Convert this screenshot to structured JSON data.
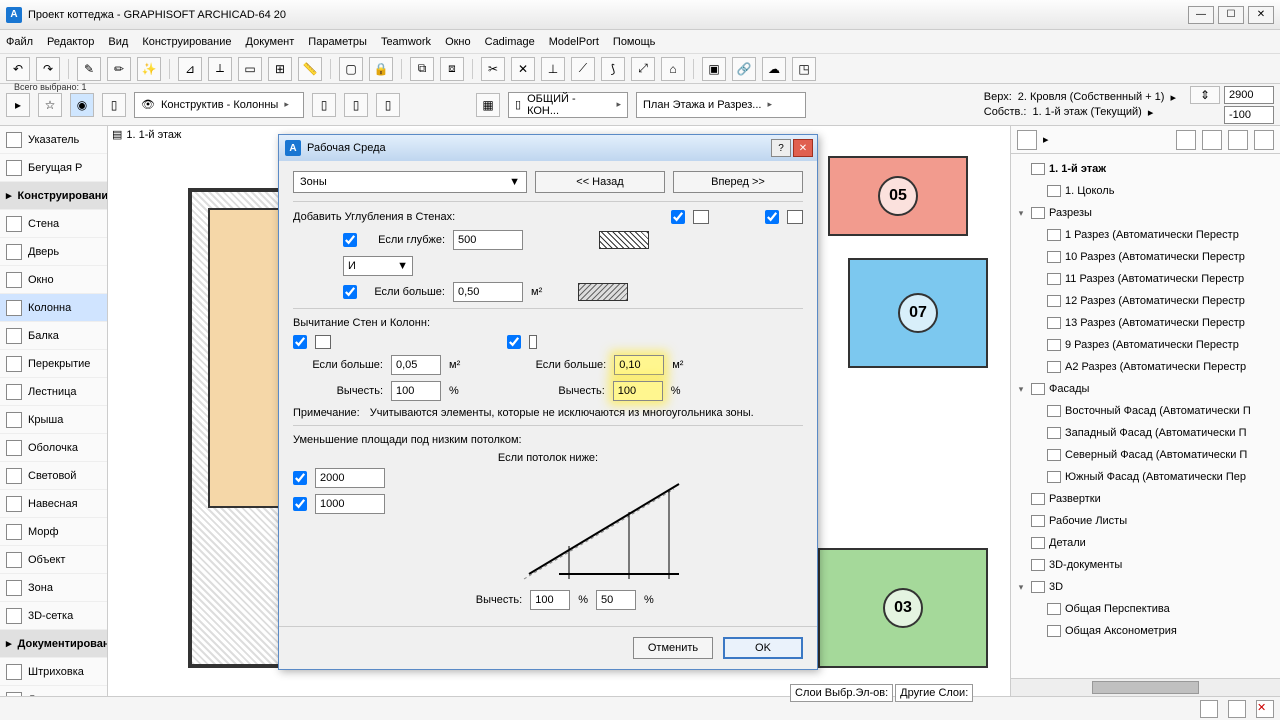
{
  "window": {
    "title": "Проект коттеджа - GRAPHISOFT ARCHICAD-64 20"
  },
  "menu": [
    "Файл",
    "Редактор",
    "Вид",
    "Конструирование",
    "Документ",
    "Параметры",
    "Teamwork",
    "Окно",
    "Cadimage",
    "ModelPort",
    "Помощь"
  ],
  "toolbar2": {
    "selection_label": "Всего выбрано: 1",
    "combo1": "Конструктив - Колонны",
    "combo2": "ОБЩИЙ - КОН...",
    "combo3": "План Этажа и Разрез...",
    "level_top_label": "Верх:",
    "level_top_value": "2. Кровля (Собственный + 1)",
    "level_bot_label": "Собств.:",
    "level_bot_value": "1. 1-й этаж (Текущий)",
    "height_top": "2900",
    "height_bot": "-100"
  },
  "left_tools": {
    "arrow": "Указатель",
    "marquee": "Бегущая Р",
    "h_construct": "Конструирование",
    "wall": "Стена",
    "door": "Дверь",
    "window": "Окно",
    "column": "Колонна",
    "beam": "Балка",
    "slab": "Перекрытие",
    "stair": "Лестница",
    "roof": "Крыша",
    "shell": "Оболочка",
    "light": "Световой",
    "curtain": "Навесная",
    "morph": "Морф",
    "object": "Объект",
    "zone": "Зона",
    "mesh": "3D-сетка",
    "h_document": "Документирование",
    "hatch": "Штриховка",
    "line": "Линия"
  },
  "canvas": {
    "tab": "1. 1-й этаж",
    "zones": {
      "z05": "05",
      "z07": "07",
      "z03": "03"
    }
  },
  "tree": {
    "root": "1. 1-й этаж",
    "items": [
      "1. Цоколь",
      "Разрезы",
      "1 Разрез (Автоматически Перестр",
      "10 Разрез (Автоматически Перестр",
      "11 Разрез (Автоматически Перестр",
      "12 Разрез (Автоматически Перестр",
      "13 Разрез (Автоматически Перестр",
      "9 Разрез (Автоматически Перестр",
      "A2 Разрез (Автоматически Перестр",
      "Фасады",
      "Восточный Фасад (Автоматически П",
      "Западный Фасад (Автоматически П",
      "Северный Фасад (Автоматически П",
      "Южный Фасад (Автоматически Пер",
      "Развертки",
      "Рабочие Листы",
      "Детали",
      "3D-документы",
      "3D",
      "Общая Перспектива",
      "Общая Аксонометрия"
    ]
  },
  "dialog": {
    "title": "Рабочая Среда",
    "select": "Зоны",
    "back": "<< Назад",
    "forward": "Вперед >>",
    "add_recess": "Добавить Углубления в Стенах:",
    "if_deeper": "Если глубже:",
    "depth_val": "500",
    "and": "И",
    "if_larger": "Если больше:",
    "larger_val": "0,50",
    "unit_m2": "м²",
    "subtract_title": "Вычитание Стен и Колонн:",
    "if_larger2": "Если больше:",
    "wall_larger": "0,05",
    "col_larger": "0,10",
    "subtract_lbl": "Вычесть:",
    "wall_sub": "100",
    "col_sub": "100",
    "pct": "%",
    "note_lbl": "Примечание:",
    "note_txt": "Учитываются элементы, которые не исключаются из многоугольника зоны.",
    "reduce_title": "Уменьшение площади под низким потолком:",
    "if_ceiling": "Если потолок ниже:",
    "h1": "2000",
    "h2": "1000",
    "sub2": "Вычесть:",
    "v1": "100",
    "v2": "50",
    "cancel": "Отменить",
    "ok": "OK"
  },
  "status": {
    "layers1": "Слои Выбр.Эл-ов:",
    "layers2": "Другие Слои:"
  }
}
